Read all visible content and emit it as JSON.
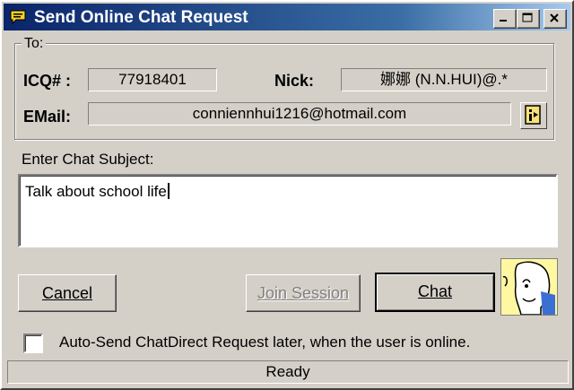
{
  "window": {
    "title": "Send Online Chat Request"
  },
  "title_buttons": {
    "minimize": "minimize-icon",
    "maximize": "maximize-icon",
    "close": "close-icon"
  },
  "to_group": {
    "legend": "To:",
    "icq_label": "ICQ# :",
    "icq_value": "77918401",
    "nick_label": "Nick:",
    "nick_value": "娜娜 (N.N.HUI)@.*",
    "email_label": "EMail:",
    "email_value": "conniennhui1216@hotmail.com",
    "info_icon": "user-info-icon"
  },
  "subject": {
    "label": "Enter Chat Subject:",
    "value": "Talk about school life"
  },
  "buttons": {
    "cancel": "Cancel",
    "join_session": "Join Session",
    "chat": "Chat"
  },
  "auto_send": {
    "checked": false,
    "label": "Auto-Send ChatDirect Request later, when the user is online."
  },
  "status": {
    "text": "Ready"
  },
  "colors": {
    "title_bar_start": "#0a246a",
    "title_bar_end": "#a6caf0",
    "face": "#d4d0c8",
    "avatar_bg": "#fff8a0"
  }
}
